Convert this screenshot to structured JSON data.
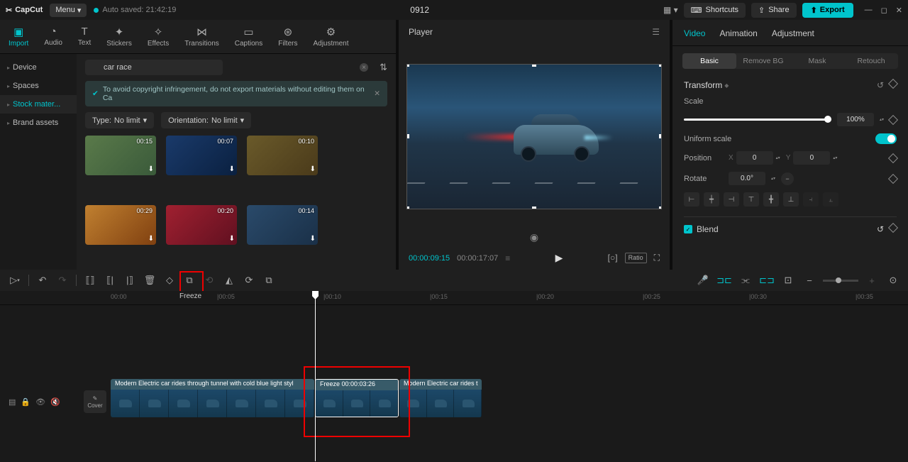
{
  "titlebar": {
    "brand": "CapCut",
    "menu": "Menu",
    "autosave": "Auto saved: 21:42:19",
    "project": "0912",
    "shortcuts": "Shortcuts",
    "share": "Share",
    "export": "Export"
  },
  "tabs": [
    "Import",
    "Audio",
    "Text",
    "Stickers",
    "Effects",
    "Transitions",
    "Captions",
    "Filters",
    "Adjustment"
  ],
  "sidebar": {
    "items": [
      "Device",
      "Spaces",
      "Stock mater...",
      "Brand assets"
    ]
  },
  "search": {
    "value": "car race"
  },
  "copyright_warning": "To avoid copyright infringement, do not export materials without editing them on Ca",
  "filters": {
    "type_label": "Type:",
    "type_value": "No limit",
    "orientation_label": "Orientation:",
    "orientation_value": "No limit"
  },
  "thumbs": [
    {
      "dur": "00:15"
    },
    {
      "dur": "00:07"
    },
    {
      "dur": "00:10"
    },
    {
      "dur": "00:29"
    },
    {
      "dur": "00:20"
    },
    {
      "dur": "00:14"
    }
  ],
  "player": {
    "title": "Player",
    "current": "00:00:09:15",
    "total": "00:00:17:07",
    "ratio_label": "Ratio"
  },
  "props": {
    "tabs": [
      "Video",
      "Animation",
      "Adjustment"
    ],
    "subtabs": [
      "Basic",
      "Remove BG",
      "Mask",
      "Retouch"
    ],
    "transform": "Transform",
    "scale": "Scale",
    "scale_value": "100%",
    "uniform_scale": "Uniform scale",
    "position": "Position",
    "pos_x_label": "X",
    "pos_x": "0",
    "pos_y_label": "Y",
    "pos_y": "0",
    "rotate": "Rotate",
    "rotate_value": "0.0°",
    "blend": "Blend"
  },
  "timeline": {
    "freeze_tooltip": "Freeze",
    "cover": "Cover",
    "ruler": [
      "00:00",
      "|00:05",
      "|00:10",
      "|00:15",
      "|00:20",
      "|00:25",
      "|00:30",
      "|00:35"
    ],
    "clip1_label": "Modern Electric car rides through tunnel with cold blue light styl",
    "clip2_label": "Freeze  00:00:03:26",
    "clip3_label": "Modern Electric car rides t"
  }
}
